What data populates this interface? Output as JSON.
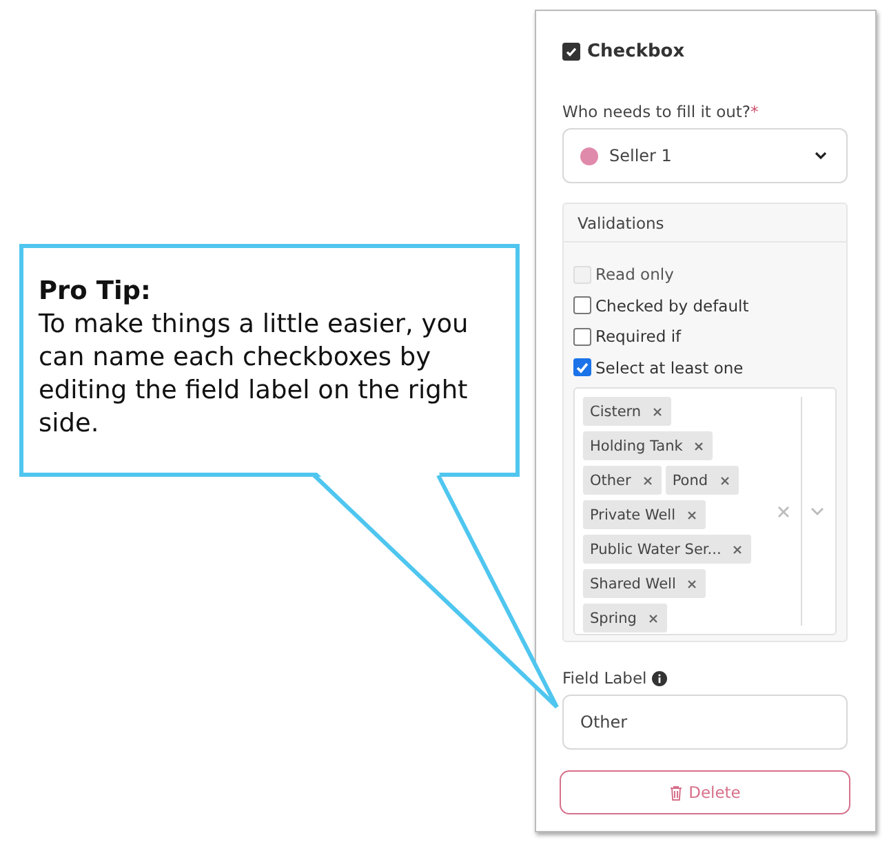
{
  "callout": {
    "title": "Pro Tip:",
    "body": "To make things a little easier, you can name each checkboxes by editing the field label on the right side."
  },
  "panel": {
    "title": "Checkbox",
    "assignee_label": "Who needs to fill it out?",
    "required_mark": "*",
    "assignee": {
      "name": "Seller 1",
      "color": "#e08aab"
    },
    "validations_title": "Validations",
    "validations": [
      {
        "label": "Read only",
        "checked": false,
        "disabled": true
      },
      {
        "label": "Checked by default",
        "checked": false,
        "disabled": false
      },
      {
        "label": "Required if",
        "checked": false,
        "disabled": false
      },
      {
        "label": "Select at least one",
        "checked": true,
        "disabled": false
      }
    ],
    "options": [
      "Cistern",
      "Holding Tank",
      "Other",
      "Pond",
      "Private Well",
      "Public Water Ser...",
      "Shared Well",
      "Spring"
    ],
    "field_label": "Field Label",
    "field_value": "Other",
    "delete_label": "Delete"
  }
}
